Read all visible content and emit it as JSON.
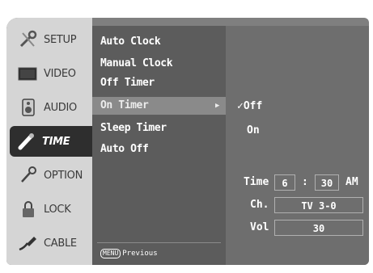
{
  "sidebar": {
    "tabs": [
      {
        "label": "SETUP",
        "icon": "wrench-screwdriver-icon"
      },
      {
        "label": "VIDEO",
        "icon": "monitor-icon"
      },
      {
        "label": "AUDIO",
        "icon": "speaker-icon"
      },
      {
        "label": "TIME",
        "icon": "clock-hand-icon"
      },
      {
        "label": "OPTION",
        "icon": "key-icon"
      },
      {
        "label": "LOCK",
        "icon": "padlock-icon"
      },
      {
        "label": "CABLE",
        "icon": "cable-plug-icon"
      }
    ],
    "active": "TIME"
  },
  "menu": {
    "items": [
      "Auto Clock",
      "Manual Clock",
      "Off Timer",
      "On Timer",
      "Sleep Timer",
      "Auto Off"
    ],
    "selected": "On Timer",
    "arrow": "▶",
    "footer_key": "MENU",
    "footer_text": "Previous"
  },
  "detail": {
    "options": [
      {
        "label": "Off",
        "checked": true
      },
      {
        "label": "On",
        "checked": false
      }
    ],
    "checkmark": "✓",
    "time_label": "Time",
    "time_hour": "6",
    "time_sep": ":",
    "time_minute": "30",
    "time_ampm": "AM",
    "channel_label": "Ch.",
    "channel_value": "TV 3-0",
    "volume_label": "Vol",
    "volume_value": "30"
  },
  "colors": {
    "osd_background": "#7f7f7f",
    "sidebar": "#d5d5d5",
    "active_tab": "#2e2e2e",
    "menu_panel": "#5c5c5c",
    "highlight": "#8a8a8a",
    "detail_panel": "#6e6e6e",
    "text": "#ffffff"
  }
}
